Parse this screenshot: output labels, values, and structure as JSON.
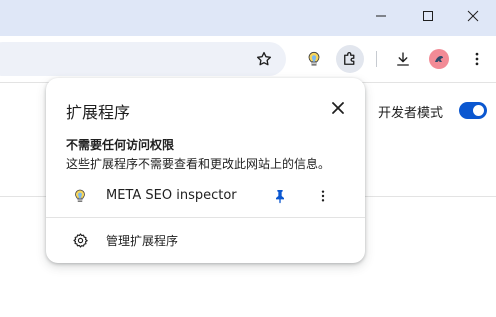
{
  "window_controls": {
    "icons": [
      "minimize-icon",
      "maximize-icon",
      "close-icon"
    ]
  },
  "toolbar": {
    "icons": [
      "star-icon",
      "lightbulb-icon",
      "puzzle-icon",
      "download-icon",
      "avatar-icon",
      "more-vert-icon"
    ],
    "accent": "#0b57d0"
  },
  "page": {
    "developer_mode_label": "开发者模式",
    "developer_mode_on": true
  },
  "popup": {
    "title": "扩展程序",
    "section_heading": "不需要任何访问权限",
    "section_description": "这些扩展程序不需要查看和更改此网站上的信息。",
    "extension": {
      "name": "META SEO inspector",
      "icon": "lightbulb-icon",
      "pinned": true
    },
    "manage_label": "管理扩展程序"
  }
}
